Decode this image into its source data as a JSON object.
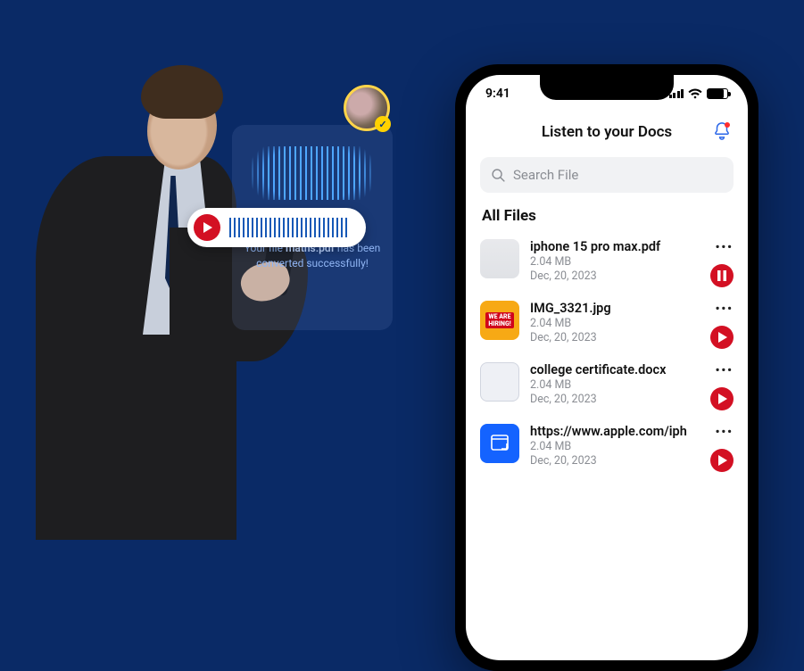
{
  "phone": {
    "status_time": "9:41",
    "header_title": "Listen to your Docs",
    "search_placeholder": "Search File",
    "section_title": "All Files"
  },
  "files": [
    {
      "name": "iphone 15 pro max.pdf",
      "size": "2.04 MB",
      "date": "Dec, 20, 2023",
      "thumb": "doc",
      "state": "pause"
    },
    {
      "name": "IMG_3321.jpg",
      "size": "2.04 MB",
      "date": "Dec, 20, 2023",
      "thumb": "hiring",
      "state": "play"
    },
    {
      "name": "college certificate.docx",
      "size": "2.04 MB",
      "date": "Dec, 20, 2023",
      "thumb": "cert",
      "state": "play"
    },
    {
      "name": "https://www.apple.com/iph",
      "size": "2.04 MB",
      "date": "Dec, 20, 2023",
      "thumb": "web",
      "state": "play"
    }
  ],
  "card": {
    "line_before": "Your file ",
    "filename": "maths.pdf",
    "line_after": " has been converted successfully!"
  }
}
